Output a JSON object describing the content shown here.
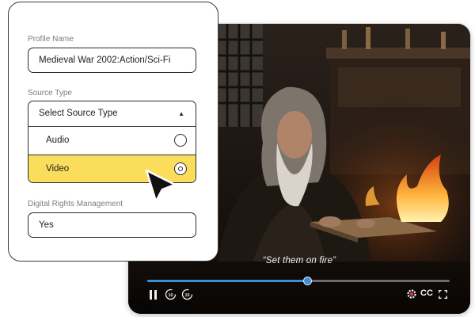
{
  "player": {
    "subtitle": "“Set them on fire”",
    "progress_fraction": 0.53,
    "cc_label": "CC",
    "skip_back_label": "10",
    "skip_forward_label": "10",
    "accent_color": "#3c8fd6"
  },
  "form": {
    "profile_name": {
      "label": "Profile Name",
      "value": "Medieval War 2002:Action/Sci-Fi"
    },
    "source_type": {
      "label": "Source Type",
      "placeholder": "Select Source Type",
      "options": [
        {
          "label": "Audio",
          "selected": false
        },
        {
          "label": "Video",
          "selected": true
        }
      ]
    },
    "drm": {
      "label": "Digital Rights Management",
      "value": "Yes"
    },
    "highlight_color": "#fbdd5c"
  },
  "icons": {
    "pause": "pause-icon",
    "skip_back": "rewind-10-icon",
    "skip_forward": "forward-10-icon",
    "settings": "settings-icon",
    "fullscreen": "fullscreen-icon",
    "caret": "caret-up-icon",
    "cursor": "mouse-pointer-icon"
  }
}
